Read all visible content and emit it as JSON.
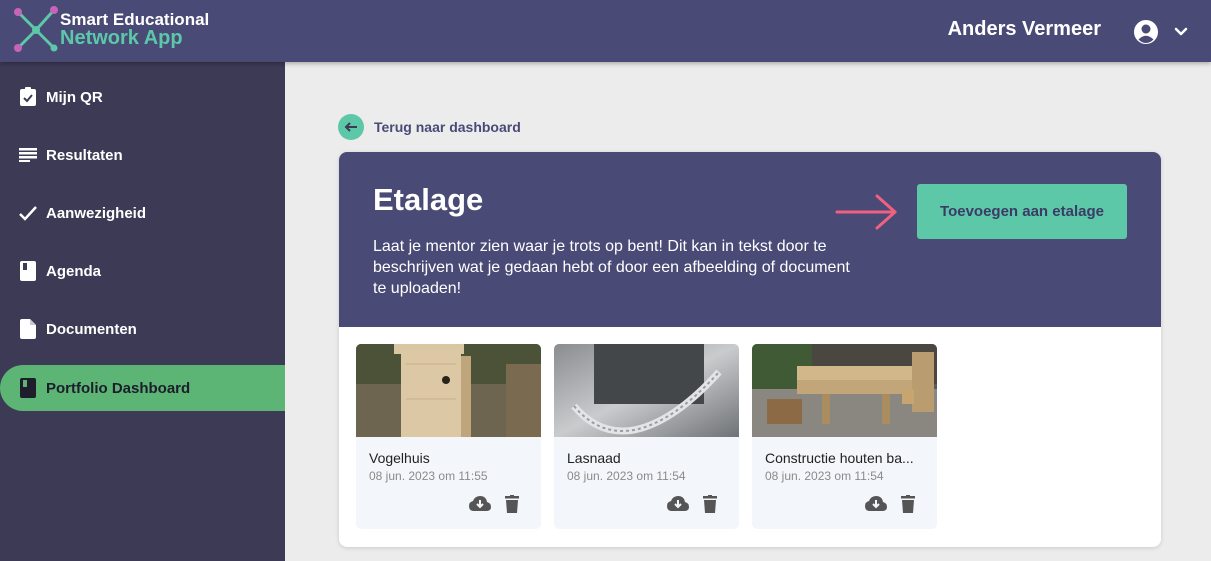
{
  "app": {
    "title_line1": "Smart Educational",
    "title_line2": "Network App"
  },
  "user": {
    "name": "Anders Vermeer"
  },
  "sidebar": {
    "items": [
      {
        "label": "Mijn QR",
        "icon": "clipboard-check-icon",
        "active": false
      },
      {
        "label": "Resultaten",
        "icon": "list-lines-icon",
        "active": false
      },
      {
        "label": "Aanwezigheid",
        "icon": "checkmark-icon",
        "active": false
      },
      {
        "label": "Agenda",
        "icon": "book-icon",
        "active": false
      },
      {
        "label": "Documenten",
        "icon": "file-icon",
        "active": false
      },
      {
        "label": "Portfolio Dashboard",
        "icon": "book-icon",
        "active": true
      }
    ]
  },
  "main": {
    "back_label": "Terug naar dashboard",
    "showcase": {
      "title": "Etalage",
      "description": "Laat je mentor zien waar je trots op bent! Dit kan in tekst door te beschrijven wat je gedaan hebt of door een afbeelding of document te uploaden!",
      "add_button": "Toevoegen aan etalage",
      "items": [
        {
          "title": "Vogelhuis",
          "date": "08 jun. 2023 om 11:55"
        },
        {
          "title": "Lasnaad",
          "date": "08 jun. 2023 om 11:54"
        },
        {
          "title": "Constructie houten ba...",
          "date": "08 jun. 2023 om 11:54"
        }
      ]
    }
  },
  "colors": {
    "header": "#4a4a77",
    "sidebar": "#3d3a55",
    "accent": "#5cc8a8",
    "active_nav": "#5cb575",
    "arrow": "#f0617f"
  }
}
